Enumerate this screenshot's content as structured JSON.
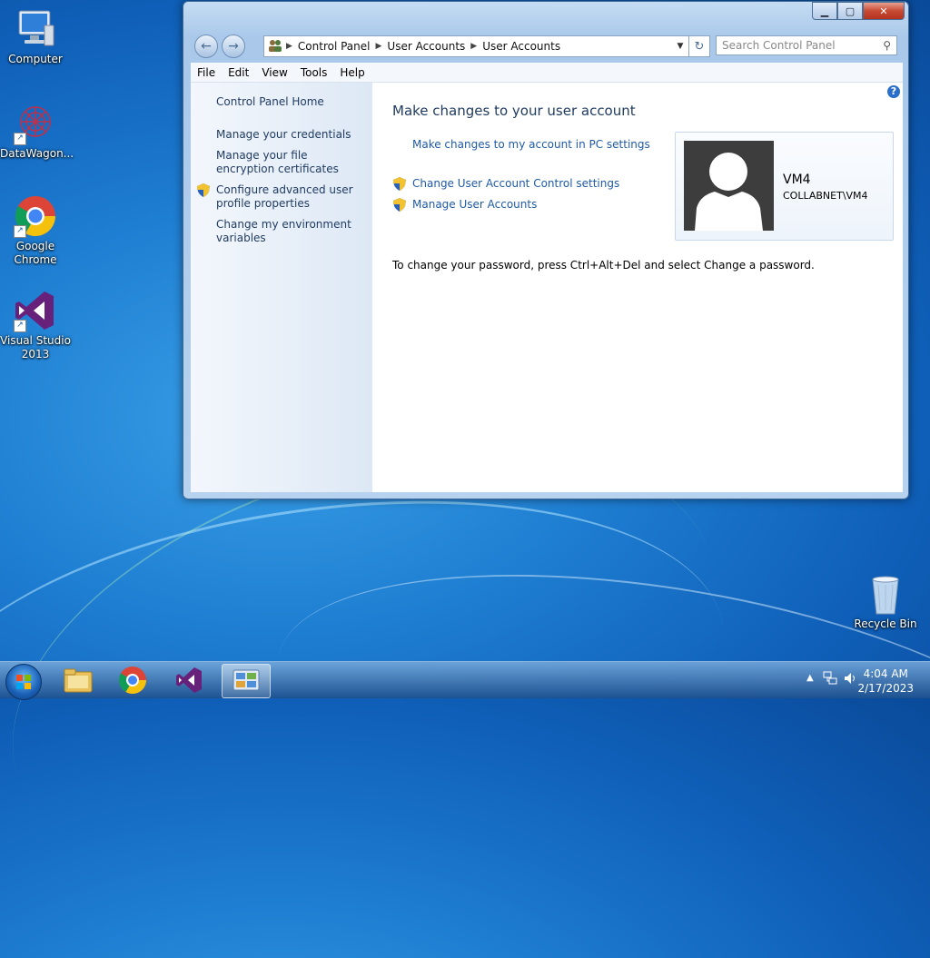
{
  "desktop": {
    "icons": [
      {
        "label": "Computer"
      },
      {
        "label": "DataWagon..."
      },
      {
        "label": "Google Chrome"
      },
      {
        "label": "Visual Studio 2013"
      },
      {
        "label": "Recycle Bin"
      }
    ]
  },
  "window": {
    "breadcrumb": [
      "Control Panel",
      "User Accounts",
      "User Accounts"
    ],
    "search_placeholder": "Search Control Panel",
    "menu": [
      "File",
      "Edit",
      "View",
      "Tools",
      "Help"
    ],
    "left_pane": {
      "home": "Control Panel Home",
      "links": [
        "Manage your credentials",
        "Manage your file encryption certificates",
        "Configure advanced user profile properties",
        "Change my environment variables"
      ]
    },
    "content": {
      "heading": "Make changes to your user account",
      "pc_settings_link": "Make changes to my account in PC settings",
      "uac_link": "Change User Account Control settings",
      "manage_link": "Manage User Accounts",
      "password_info": "To change your password, press Ctrl+Alt+Del and select Change a password.",
      "user_name": "VM4",
      "user_domain": "COLLABNET\\VM4"
    }
  },
  "taskbar": {
    "time": "4:04 AM",
    "date": "2/17/2023"
  }
}
